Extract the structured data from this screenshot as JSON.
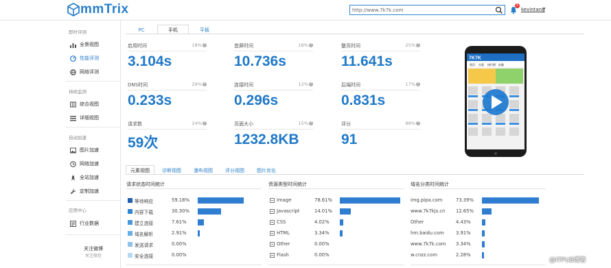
{
  "header": {
    "logo_text": "mmTrix",
    "search_value": "http://www.7k7k.com",
    "notification_count": "1",
    "username": "kevintang"
  },
  "sidebar": {
    "sections": [
      {
        "title": "即时评测",
        "items": [
          {
            "label": "全景视图",
            "icon": "bar-chart-icon",
            "active": false
          },
          {
            "label": "性能评测",
            "icon": "gauge-icon",
            "active": true
          },
          {
            "label": "网络评测",
            "icon": "globe-icon",
            "active": false
          }
        ]
      },
      {
        "title": "持续监测",
        "items": [
          {
            "label": "综合视图",
            "icon": "columns-icon",
            "active": false
          },
          {
            "label": "详细视图",
            "icon": "list-icon",
            "active": false
          }
        ]
      },
      {
        "title": "自动加速",
        "items": [
          {
            "label": "图片加速",
            "icon": "image-icon",
            "active": false
          },
          {
            "label": "网络加速",
            "icon": "clock-icon",
            "active": false
          },
          {
            "label": "全站加速",
            "icon": "rocket-icon",
            "active": false
          },
          {
            "label": "定制加速",
            "icon": "wrench-icon",
            "active": false
          }
        ]
      },
      {
        "title": "应用中心",
        "items": [
          {
            "label": "行业数据",
            "icon": "data-icon",
            "active": false
          }
        ]
      }
    ],
    "follow_title": "关注微博",
    "follow_sub": "关注微信"
  },
  "device_tabs": [
    {
      "label": "PC",
      "active": false
    },
    {
      "label": "手机",
      "active": true
    },
    {
      "label": "平板",
      "active": false
    }
  ],
  "metrics": [
    {
      "label": "启用时间",
      "percent": "18%",
      "value": "3.104s"
    },
    {
      "label": "首屏时间",
      "percent": "18%",
      "value": "10.736s"
    },
    {
      "label": "整页时间",
      "percent": "25%",
      "value": "11.641s"
    },
    {
      "label": "DNS时间",
      "percent": "29%",
      "value": "0.233s"
    },
    {
      "label": "连接时间",
      "percent": "12%",
      "value": "0.296s"
    },
    {
      "label": "后端时间",
      "percent": "17%",
      "value": "0.831s"
    },
    {
      "label": "请求数",
      "percent": "24%",
      "value": "59次"
    },
    {
      "label": "页面大小",
      "percent": "15%",
      "value": "1232.8KB"
    },
    {
      "label": "评分",
      "percent": "88%",
      "value": "91"
    }
  ],
  "phone_preview": {
    "site_logo": "7K7K",
    "nav_items": [
      "首页",
      "分类",
      "排行榜",
      "必备"
    ]
  },
  "sub_tabs": [
    {
      "label": "元素视图",
      "active": true
    },
    {
      "label": "诊断视图",
      "active": false
    },
    {
      "label": "瀑布视图",
      "active": false
    },
    {
      "label": "评分视图",
      "active": false
    },
    {
      "label": "图片优化",
      "active": false
    }
  ],
  "panels": [
    {
      "title": "请求状态时间统计",
      "rows": [
        {
          "label": "等待响应",
          "percent": "59.18%",
          "fraction": 0.5918,
          "color": "#1f5fae"
        },
        {
          "label": "内容下载",
          "percent": "30.30%",
          "fraction": 0.303,
          "color": "#2e86d4"
        },
        {
          "label": "建立连接",
          "percent": "7.61%",
          "fraction": 0.0761,
          "color": "#4a98dc"
        },
        {
          "label": "域名解析",
          "percent": "2.91%",
          "fraction": 0.0291,
          "color": "#6aaee6"
        },
        {
          "label": "发送请求",
          "percent": "0.00%",
          "fraction": 0,
          "color": "#8fc3ee"
        },
        {
          "label": "安全连接",
          "percent": "0.00%",
          "fraction": 0,
          "color": "#b5d8f5"
        }
      ]
    },
    {
      "title": "资源类型时间统计",
      "rows": [
        {
          "label": "Image",
          "percent": "78.61%",
          "fraction": 0.7861,
          "icon": "image-file-icon"
        },
        {
          "label": "Javascript",
          "percent": "14.01%",
          "fraction": 0.1401,
          "icon": "js-file-icon"
        },
        {
          "label": "CSS",
          "percent": "4.02%",
          "fraction": 0.0402,
          "icon": "css-file-icon"
        },
        {
          "label": "HTML",
          "percent": "3.34%",
          "fraction": 0.0334,
          "icon": "html-file-icon"
        },
        {
          "label": "Other",
          "percent": "0.00%",
          "fraction": 0,
          "icon": "other-file-icon"
        },
        {
          "label": "Flash",
          "percent": "0.00%",
          "fraction": 0,
          "icon": "flash-file-icon"
        }
      ]
    },
    {
      "title": "域名分类时间统计",
      "rows": [
        {
          "label": "img.pipa.com",
          "percent": "73.39%",
          "fraction": 0.7339
        },
        {
          "label": "www.7k7kjs.cn",
          "percent": "12.65%",
          "fraction": 0.1265
        },
        {
          "label": "Other",
          "percent": "4.43%",
          "fraction": 0.0443
        },
        {
          "label": "hm.baidu.com",
          "percent": "3.91%",
          "fraction": 0.0391
        },
        {
          "label": "www.7k7k.com",
          "percent": "3.34%",
          "fraction": 0.0334
        },
        {
          "label": "w.cnzz.com",
          "percent": "2.28%",
          "fraction": 0.0228
        }
      ]
    }
  ],
  "watermark": "@ITPUB博客",
  "colors": {
    "accent": "#1f78c8",
    "bar": "#2e7dd1"
  }
}
